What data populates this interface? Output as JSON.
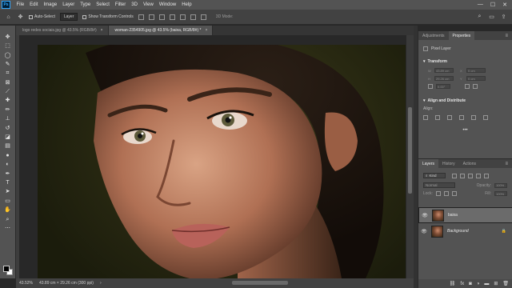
{
  "app": {
    "logo_text": "Ps"
  },
  "menu": [
    "File",
    "Edit",
    "Image",
    "Layer",
    "Type",
    "Select",
    "Filter",
    "3D",
    "View",
    "Window",
    "Help"
  ],
  "window_controls": {
    "minimize": "—",
    "maximize": "☐",
    "close": "✕"
  },
  "options": {
    "auto_select_label": "Auto-Select",
    "auto_select_target": "Layer",
    "transform_controls_label": "Show Transform Controls",
    "mode_3d_label": "3D Mode:"
  },
  "tabs": [
    {
      "label": "logo redes sociais.jpg @ 43.5% (RGB/8#)",
      "active": false
    },
    {
      "label": "woman-2354905.jpg @ 43.5% (baixa, RGB/8#) *",
      "active": true
    }
  ],
  "tab_close_glyph": "×",
  "status": {
    "zoom": "43.52%",
    "doc_size": "43.89 cm × 29.26 cm (300 ppi)",
    "arrow": "›"
  },
  "properties": {
    "tabs": [
      "Adjustments",
      "Properties"
    ],
    "layer_type": "Pixel Layer",
    "transform_title": "Transform",
    "w_label": "W",
    "h_label": "H",
    "x_label": "X",
    "y_label": "Y",
    "w_value": "43.89 cm",
    "h_value": "29.26 cm",
    "x_value": "0 cm",
    "y_value": "0 cm",
    "angle_value": "0.00°",
    "align_title": "Align and Distribute",
    "align_label": "Align:"
  },
  "layers": {
    "tabs": [
      "Layers",
      "History",
      "Actions"
    ],
    "kind_label": "Kind",
    "blend_mode": "Normal",
    "opacity_label": "Opacity:",
    "opacity_value": "100%",
    "lock_label": "Lock:",
    "fill_label": "Fill:",
    "fill_value": "100%",
    "items": [
      {
        "name": "baixa",
        "selected": true
      },
      {
        "name": "Background",
        "selected": false
      }
    ],
    "footer_icons": [
      "link-icon",
      "fx-icon",
      "mask-icon",
      "adjustment-icon",
      "group-icon",
      "new-layer-icon",
      "trash-icon"
    ]
  },
  "colors": {
    "accent": "#31a8ff",
    "panel": "#535353",
    "canvas_bg": "#282828"
  }
}
